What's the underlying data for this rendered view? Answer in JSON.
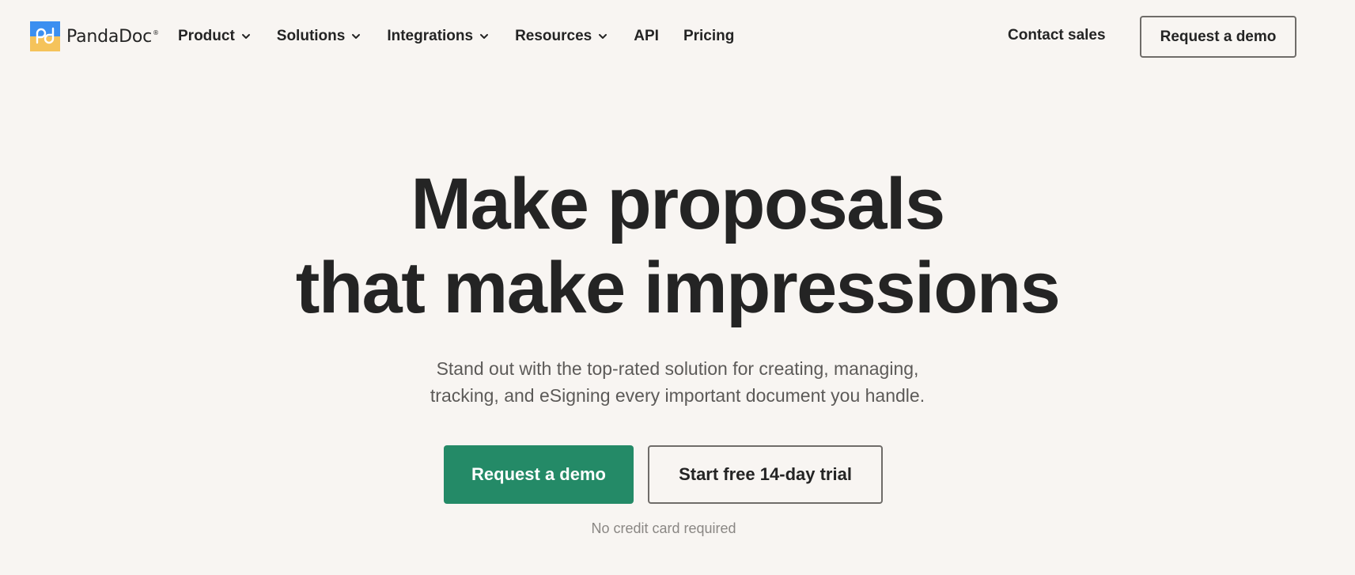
{
  "brand": {
    "name": "PandaDoc",
    "registered_mark": "®",
    "colors": {
      "logo_top": "#3b8ff0",
      "logo_bottom": "#f5c35b",
      "primary": "#248a67",
      "background": "#f8f5f2"
    }
  },
  "nav": {
    "items": [
      {
        "label": "Product",
        "has_dropdown": true
      },
      {
        "label": "Solutions",
        "has_dropdown": true
      },
      {
        "label": "Integrations",
        "has_dropdown": true
      },
      {
        "label": "Resources",
        "has_dropdown": true
      },
      {
        "label": "API",
        "has_dropdown": false
      },
      {
        "label": "Pricing",
        "has_dropdown": false
      }
    ],
    "contact_label": "Contact sales",
    "demo_label": "Request a demo"
  },
  "hero": {
    "title_line1": "Make proposals",
    "title_line2": "that make impressions",
    "subtitle_line1": "Stand out with the top-rated solution for creating, managing,",
    "subtitle_line2": "tracking, and eSigning every important document you handle.",
    "primary_cta": "Request a demo",
    "secondary_cta": "Start free 14-day trial",
    "note": "No credit card required"
  },
  "icons": {
    "dropdown": "chevron-down-icon",
    "logo": "pandadoc-logo-icon"
  }
}
